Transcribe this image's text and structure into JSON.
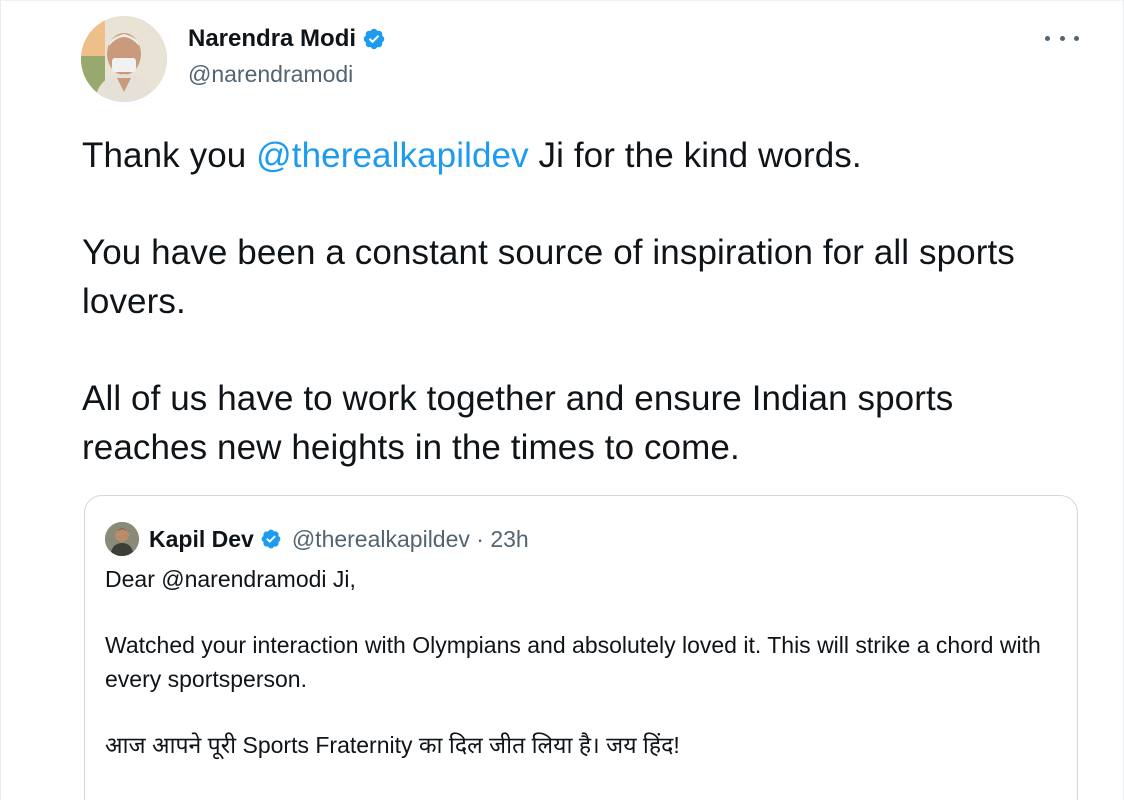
{
  "tweet": {
    "author_name": "Narendra Modi",
    "author_handle": "@narendramodi",
    "text_1_pre": "Thank you ",
    "text_1_mention": "@therealkapildev",
    "text_1_post": " Ji for the kind words.",
    "text_2": "You have been a constant source of inspiration for all sports lovers.",
    "text_3": "All of us have to work together and ensure Indian sports reaches new heights in the times to come."
  },
  "quote": {
    "author_name": "Kapil Dev",
    "meta": "@therealkapildev · 23h",
    "line_1": "Dear @narendramodi Ji,",
    "line_2": "Watched your interaction with Olympians and absolutely loved it. This will strike a chord with every sportsperson.",
    "line_3": "आज आपने पूरी Sports Fraternity का दिल जीत लिया है। जय हिंद!"
  },
  "icons": {
    "verified": "verified-badge-icon",
    "more": "more-options-icon"
  },
  "colors": {
    "accent": "#1d9bf0",
    "text": "#0f1419",
    "secondary": "#536471",
    "border": "#cfd9de"
  }
}
